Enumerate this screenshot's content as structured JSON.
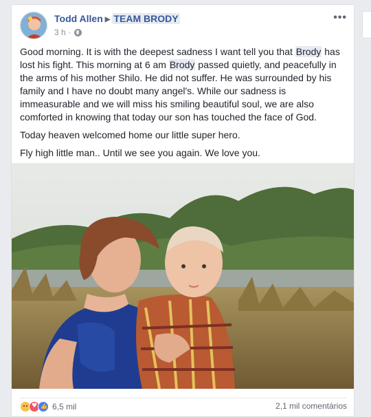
{
  "post": {
    "author": "Todd Allen",
    "group": "TEAM BRODY",
    "time": "3 h",
    "paragraphs": [
      [
        {
          "t": "Good morning. It is with the deepest sadness I want tell you that "
        },
        {
          "t": "Brody",
          "mention": true
        },
        {
          "t": " has lost his fight. This morning at 6 am "
        },
        {
          "t": "Brody",
          "mention": true
        },
        {
          "t": " passed quietly, and peacefully in the arms of his mother Shilo. He did not suffer. He was surrounded by his family and I have no doubt many angel's. While our sadness is immeasurable and we will miss his smiling beautiful soul, we are also comforted in knowing that today our son has touched the face of God."
        }
      ],
      [
        {
          "t": "Today heaven welcomed home our little super hero."
        }
      ],
      [
        {
          "t": "Fly high little man.. Until we see you again. We love you."
        }
      ]
    ]
  },
  "footer": {
    "reactions": [
      "sad",
      "love",
      "like"
    ],
    "reaction_count": "6,5 mil",
    "comments": "2,1 mil comentários"
  },
  "colors": {
    "link": "#365899",
    "mention_bg": "#e7eaf2",
    "text": "#1d2129",
    "meta": "#90949c"
  }
}
